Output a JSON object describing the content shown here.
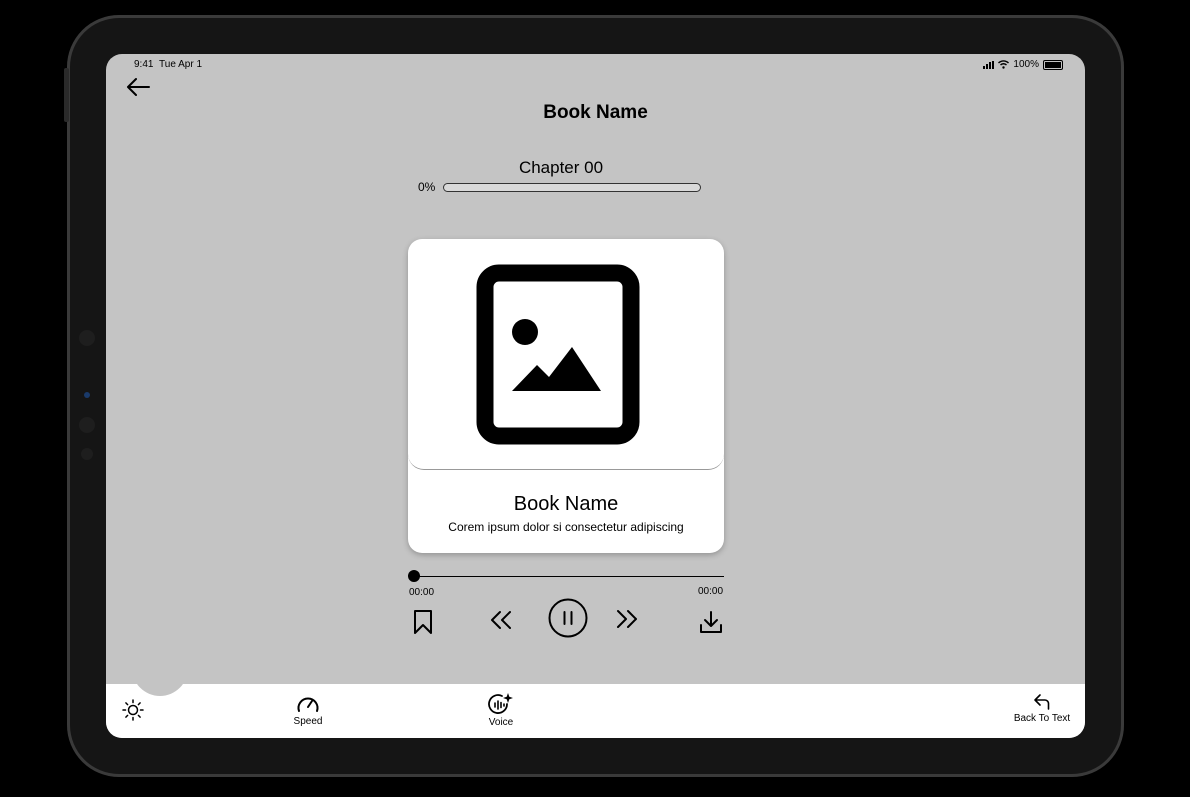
{
  "status_bar": {
    "time": "9:41",
    "date": "Tue Apr 1",
    "battery": "100%"
  },
  "header": {
    "title": "Book Name",
    "back_icon": "arrow-left-icon"
  },
  "chapter": {
    "label": "Chapter 00",
    "progress_text": "0%",
    "progress": 0
  },
  "card": {
    "title": "Book Name",
    "subtitle": "Corem ipsum dolor si consectetur adipiscing",
    "image_icon": "image-placeholder-icon"
  },
  "player": {
    "elapsed": "00:00",
    "duration": "00:00",
    "position": 0
  },
  "controls": [
    "bookmark-icon",
    "rewind-icon",
    "pause-icon",
    "fast-forward-icon",
    "download-icon"
  ],
  "tabs": {
    "brightness": {
      "label": "",
      "icon": "sun-icon"
    },
    "speed": {
      "label": "Speed",
      "icon": "speedometer-icon"
    },
    "voice": {
      "label": "Voice",
      "icon": "voice-ai-icon"
    },
    "back_to_text": {
      "label": "Back To Text",
      "icon": "return-arrow-icon"
    }
  }
}
